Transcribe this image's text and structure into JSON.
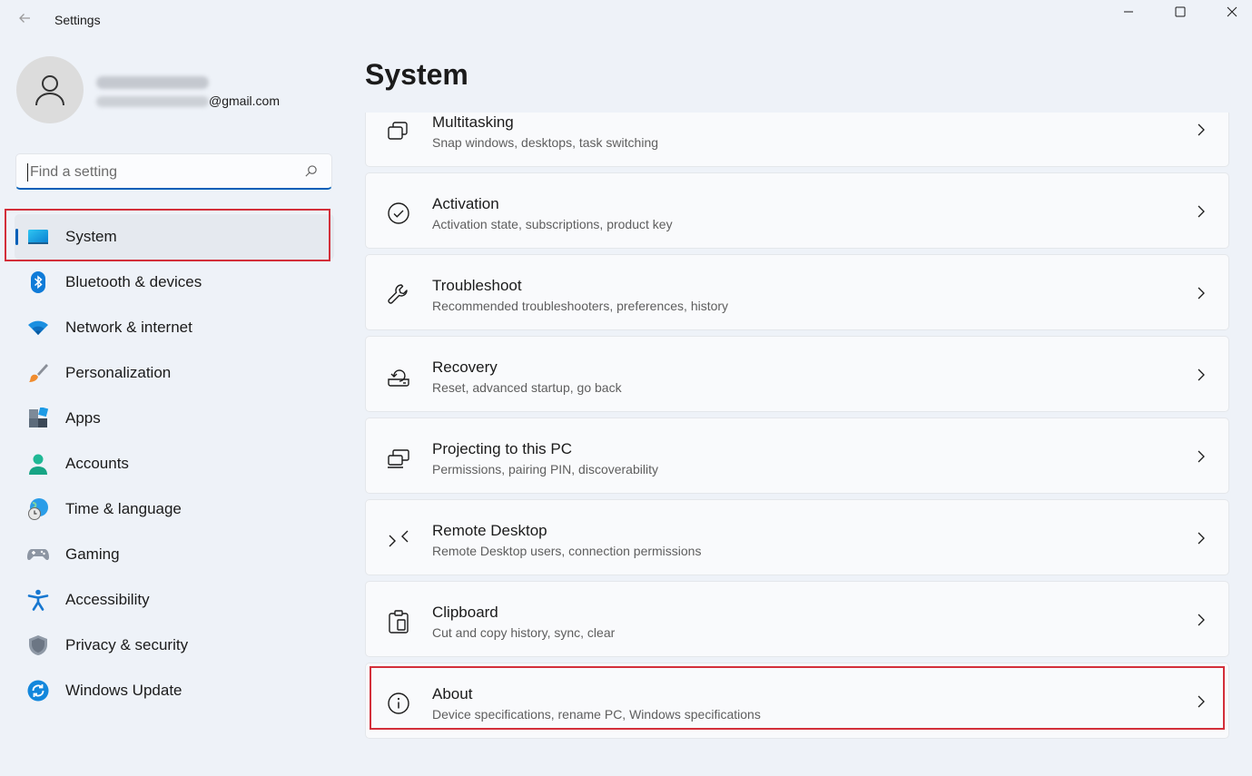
{
  "window": {
    "title": "Settings",
    "back_icon": "back-arrow-icon",
    "controls": [
      "minimize-icon",
      "maximize-icon",
      "close-icon"
    ]
  },
  "profile": {
    "name": "",
    "email_visible_suffix": "@gmail.com"
  },
  "search": {
    "placeholder": "Find a setting",
    "value": ""
  },
  "sidebar": {
    "selected": "System",
    "items": [
      {
        "label": "System",
        "icon": "system-display-icon"
      },
      {
        "label": "Bluetooth & devices",
        "icon": "bluetooth-icon"
      },
      {
        "label": "Network & internet",
        "icon": "wifi-icon"
      },
      {
        "label": "Personalization",
        "icon": "paintbrush-icon"
      },
      {
        "label": "Apps",
        "icon": "apps-icon"
      },
      {
        "label": "Accounts",
        "icon": "accounts-icon"
      },
      {
        "label": "Time & language",
        "icon": "globe-clock-icon"
      },
      {
        "label": "Gaming",
        "icon": "gamepad-icon"
      },
      {
        "label": "Accessibility",
        "icon": "accessibility-icon"
      },
      {
        "label": "Privacy & security",
        "icon": "shield-icon"
      },
      {
        "label": "Windows Update",
        "icon": "sync-icon"
      }
    ]
  },
  "main": {
    "title": "System",
    "cards": [
      {
        "title": "Multitasking",
        "subtitle": "Snap windows, desktops, task switching",
        "icon": "multitasking-icon"
      },
      {
        "title": "Activation",
        "subtitle": "Activation state, subscriptions, product key",
        "icon": "check-circle-icon"
      },
      {
        "title": "Troubleshoot",
        "subtitle": "Recommended troubleshooters, preferences, history",
        "icon": "wrench-icon"
      },
      {
        "title": "Recovery",
        "subtitle": "Reset, advanced startup, go back",
        "icon": "recovery-icon"
      },
      {
        "title": "Projecting to this PC",
        "subtitle": "Permissions, pairing PIN, discoverability",
        "icon": "projecting-icon"
      },
      {
        "title": "Remote Desktop",
        "subtitle": "Remote Desktop users, connection permissions",
        "icon": "remote-desktop-icon"
      },
      {
        "title": "Clipboard",
        "subtitle": "Cut and copy history, sync, clear",
        "icon": "clipboard-icon"
      },
      {
        "title": "About",
        "subtitle": "Device specifications, rename PC, Windows specifications",
        "icon": "info-icon"
      }
    ]
  },
  "colors": {
    "accent": "#005fb8",
    "highlight_box": "#d32f3a",
    "background": "#eef2f8",
    "card": "#f9fafc"
  }
}
